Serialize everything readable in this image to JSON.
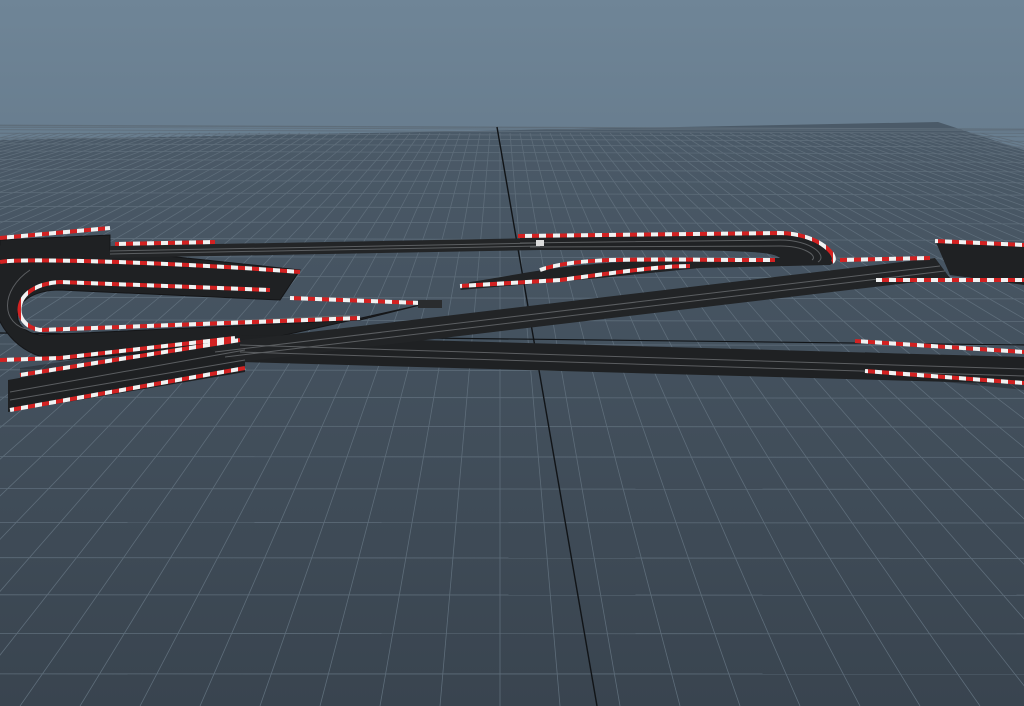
{
  "viewport": {
    "kind": "3d-viewport",
    "sky_top_color": "#6f8597",
    "sky_bottom_color": "#4a5b6b",
    "ground_color": "#3f4c58",
    "grid_minor_color": "#5e6d7a",
    "grid_major_color": "#111417",
    "track_surface_color": "#1f2123",
    "track_lane_color": "#6a6d70",
    "curb_red_color": "#d32222",
    "curb_white_color": "#f1f1f1"
  },
  "scene": {
    "object": "slot-car-race-track",
    "grid_visible": true
  }
}
